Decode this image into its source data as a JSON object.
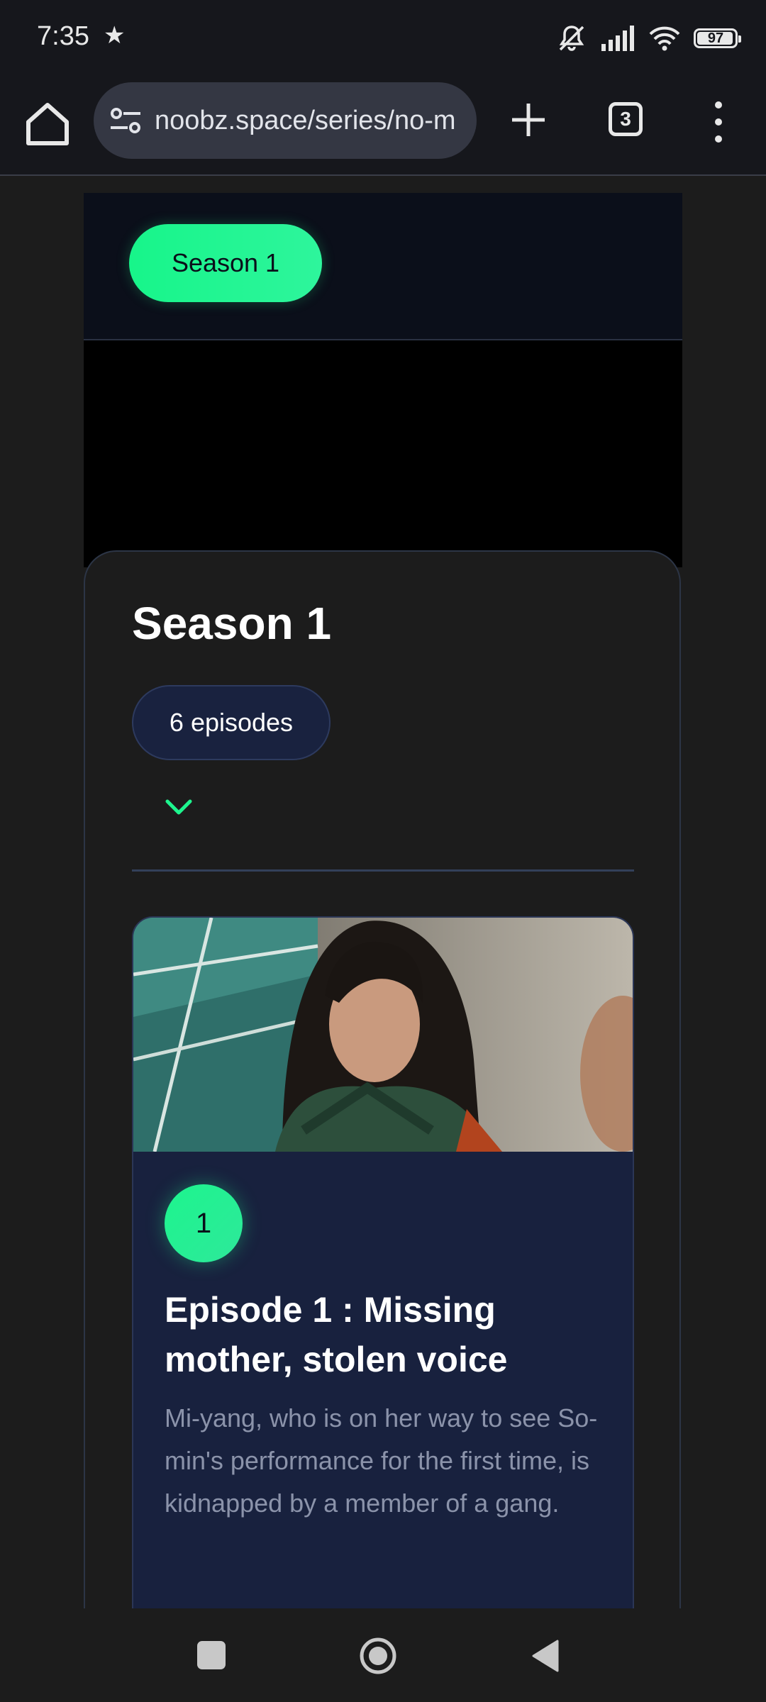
{
  "status_bar": {
    "time": "7:35",
    "battery": "97",
    "icons": [
      "star-icon",
      "mute-icon",
      "signal-icon",
      "wifi-icon",
      "battery-icon"
    ]
  },
  "browser": {
    "url": "noobz.space/series/no-m",
    "tab_count": "3",
    "icons": [
      "home-icon",
      "tune-icon",
      "plus-icon",
      "tabs-icon",
      "more-vert-icon"
    ]
  },
  "season_tabs": {
    "active_label": "Season 1"
  },
  "season_section": {
    "title": "Season 1",
    "episode_count_label": "6 episodes",
    "expand_icon": "chevron-down-icon"
  },
  "episodes": [
    {
      "number": "1",
      "title": "Episode 1 : Missing mother, stolen voice",
      "description": "Mi-yang, who is on her way to see So-min's performance for the first time, is kidnapped by a member of a gang."
    }
  ],
  "nav_bar": {
    "icons": [
      "recents-icon",
      "home-circle-icon",
      "back-icon"
    ]
  },
  "colors": {
    "accent": "#1df58e",
    "card_bg": "#18213e",
    "page_bg": "#1c1c1c",
    "header_bg": "#0b0f1a"
  }
}
